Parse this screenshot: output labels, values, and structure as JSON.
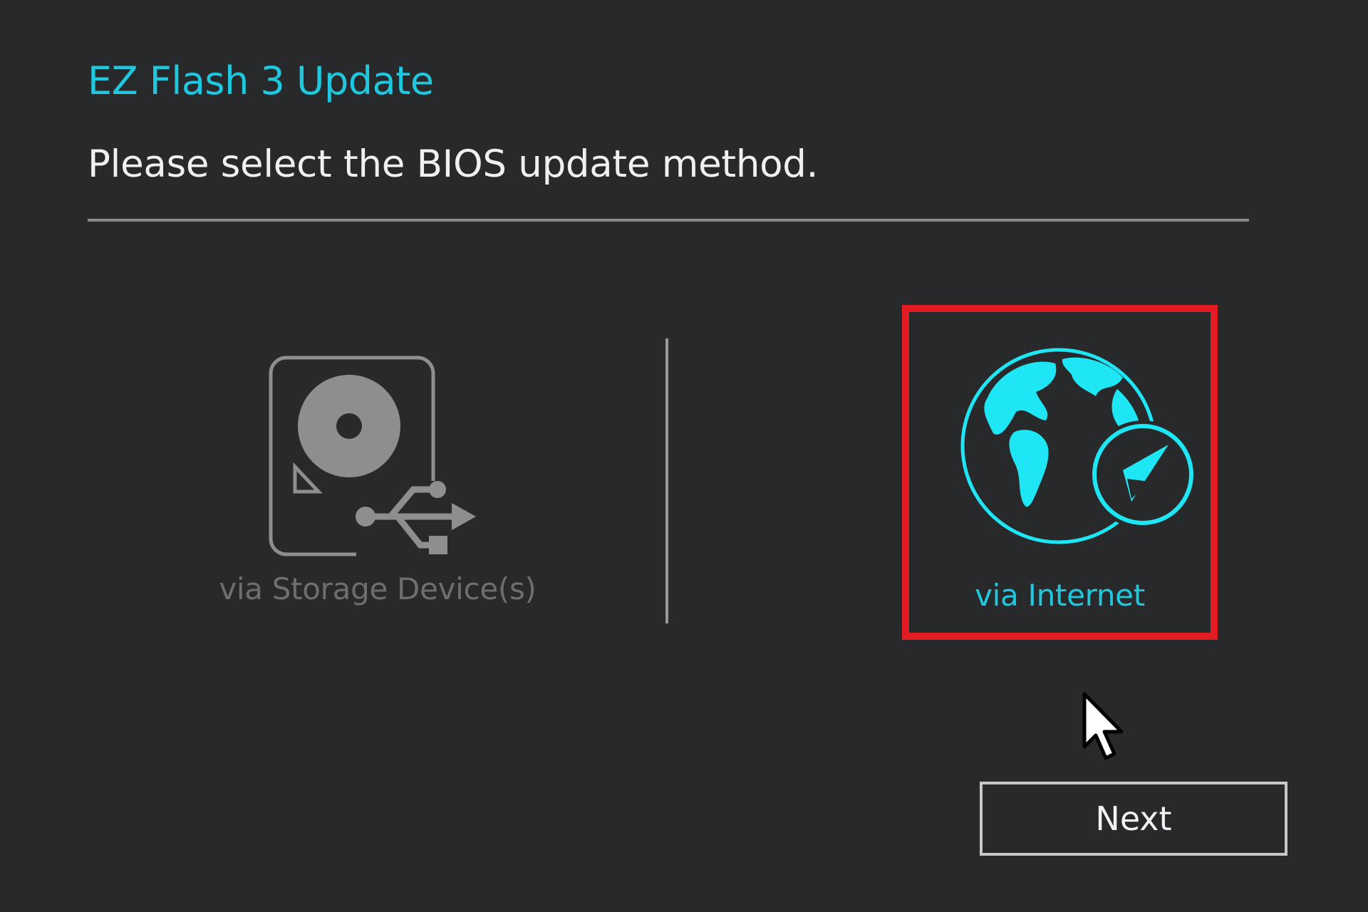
{
  "dialog": {
    "title": "EZ Flash 3 Update",
    "prompt": "Please select the BIOS update method."
  },
  "options": [
    {
      "label": "via Storage Device(s)",
      "icon": "storage-device-usb-icon",
      "selected": false
    },
    {
      "label": "via Internet",
      "icon": "globe-compass-icon",
      "selected": true
    }
  ],
  "buttons": {
    "next_label": "Next"
  },
  "colors": {
    "background": "#28292b",
    "accent": "#1fc8de",
    "highlight_frame": "#e31b23",
    "inactive": "#8e8e8e"
  }
}
